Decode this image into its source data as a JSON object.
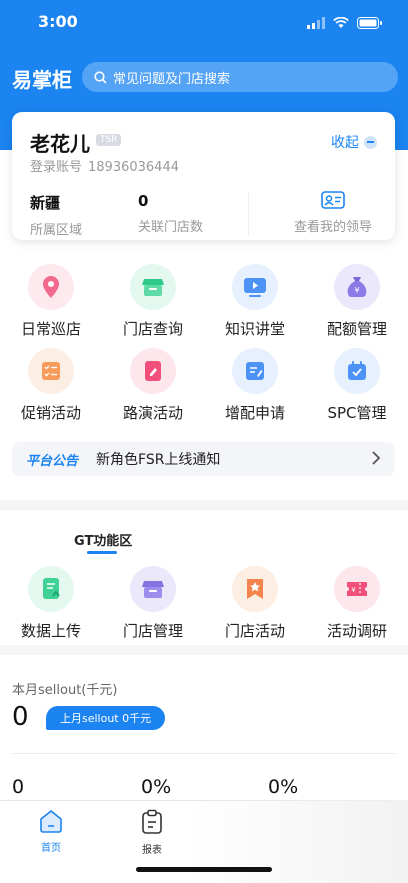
{
  "status": {
    "time": "3:00"
  },
  "header": {
    "brand": "易掌柜",
    "search_placeholder": "常见问题及门店搜索"
  },
  "profile": {
    "name": "老花儿",
    "role_tag": "TSR",
    "collapse_label": "收起",
    "account_label": "登录账号",
    "account_number": "18936036444",
    "region_value": "新疆",
    "region_label": "所属区域",
    "stores_value": "0",
    "stores_label": "关联门店数",
    "leader_label": "查看我的领导"
  },
  "quick_menu": [
    {
      "label": "日常巡店",
      "icon": "location-pin-icon"
    },
    {
      "label": "门店查询",
      "icon": "store-icon"
    },
    {
      "label": "知识讲堂",
      "icon": "video-play-icon"
    },
    {
      "label": "配额管理",
      "icon": "money-bag-icon"
    },
    {
      "label": "促销活动",
      "icon": "checklist-icon"
    },
    {
      "label": "路演活动",
      "icon": "edit-note-icon"
    },
    {
      "label": "增配申请",
      "icon": "form-edit-icon"
    },
    {
      "label": "SPC管理",
      "icon": "calendar-check-icon"
    }
  ],
  "notice": {
    "tag": "平台公告",
    "text": "新角色FSR上线通知"
  },
  "gt": {
    "title": "GT功能区",
    "items": [
      {
        "label": "数据上传",
        "icon": "document-upload-icon"
      },
      {
        "label": "门店管理",
        "icon": "store-manage-icon"
      },
      {
        "label": "门店活动",
        "icon": "star-flag-icon"
      },
      {
        "label": "活动调研",
        "icon": "ticket-icon"
      }
    ]
  },
  "sellout": {
    "title": "本月sellout(千元)",
    "value": "0",
    "last_month": "上月sellout 0千元",
    "metrics": [
      "0",
      "0%",
      "0%"
    ]
  },
  "tabbar": [
    {
      "label": "首页",
      "icon": "home-icon",
      "active": true
    },
    {
      "label": "报表",
      "icon": "report-clipboard-icon",
      "active": false
    }
  ],
  "colors": {
    "primary": "#1b84f0",
    "page_bg": "#ffffff",
    "divider": "#f4f5f7"
  }
}
